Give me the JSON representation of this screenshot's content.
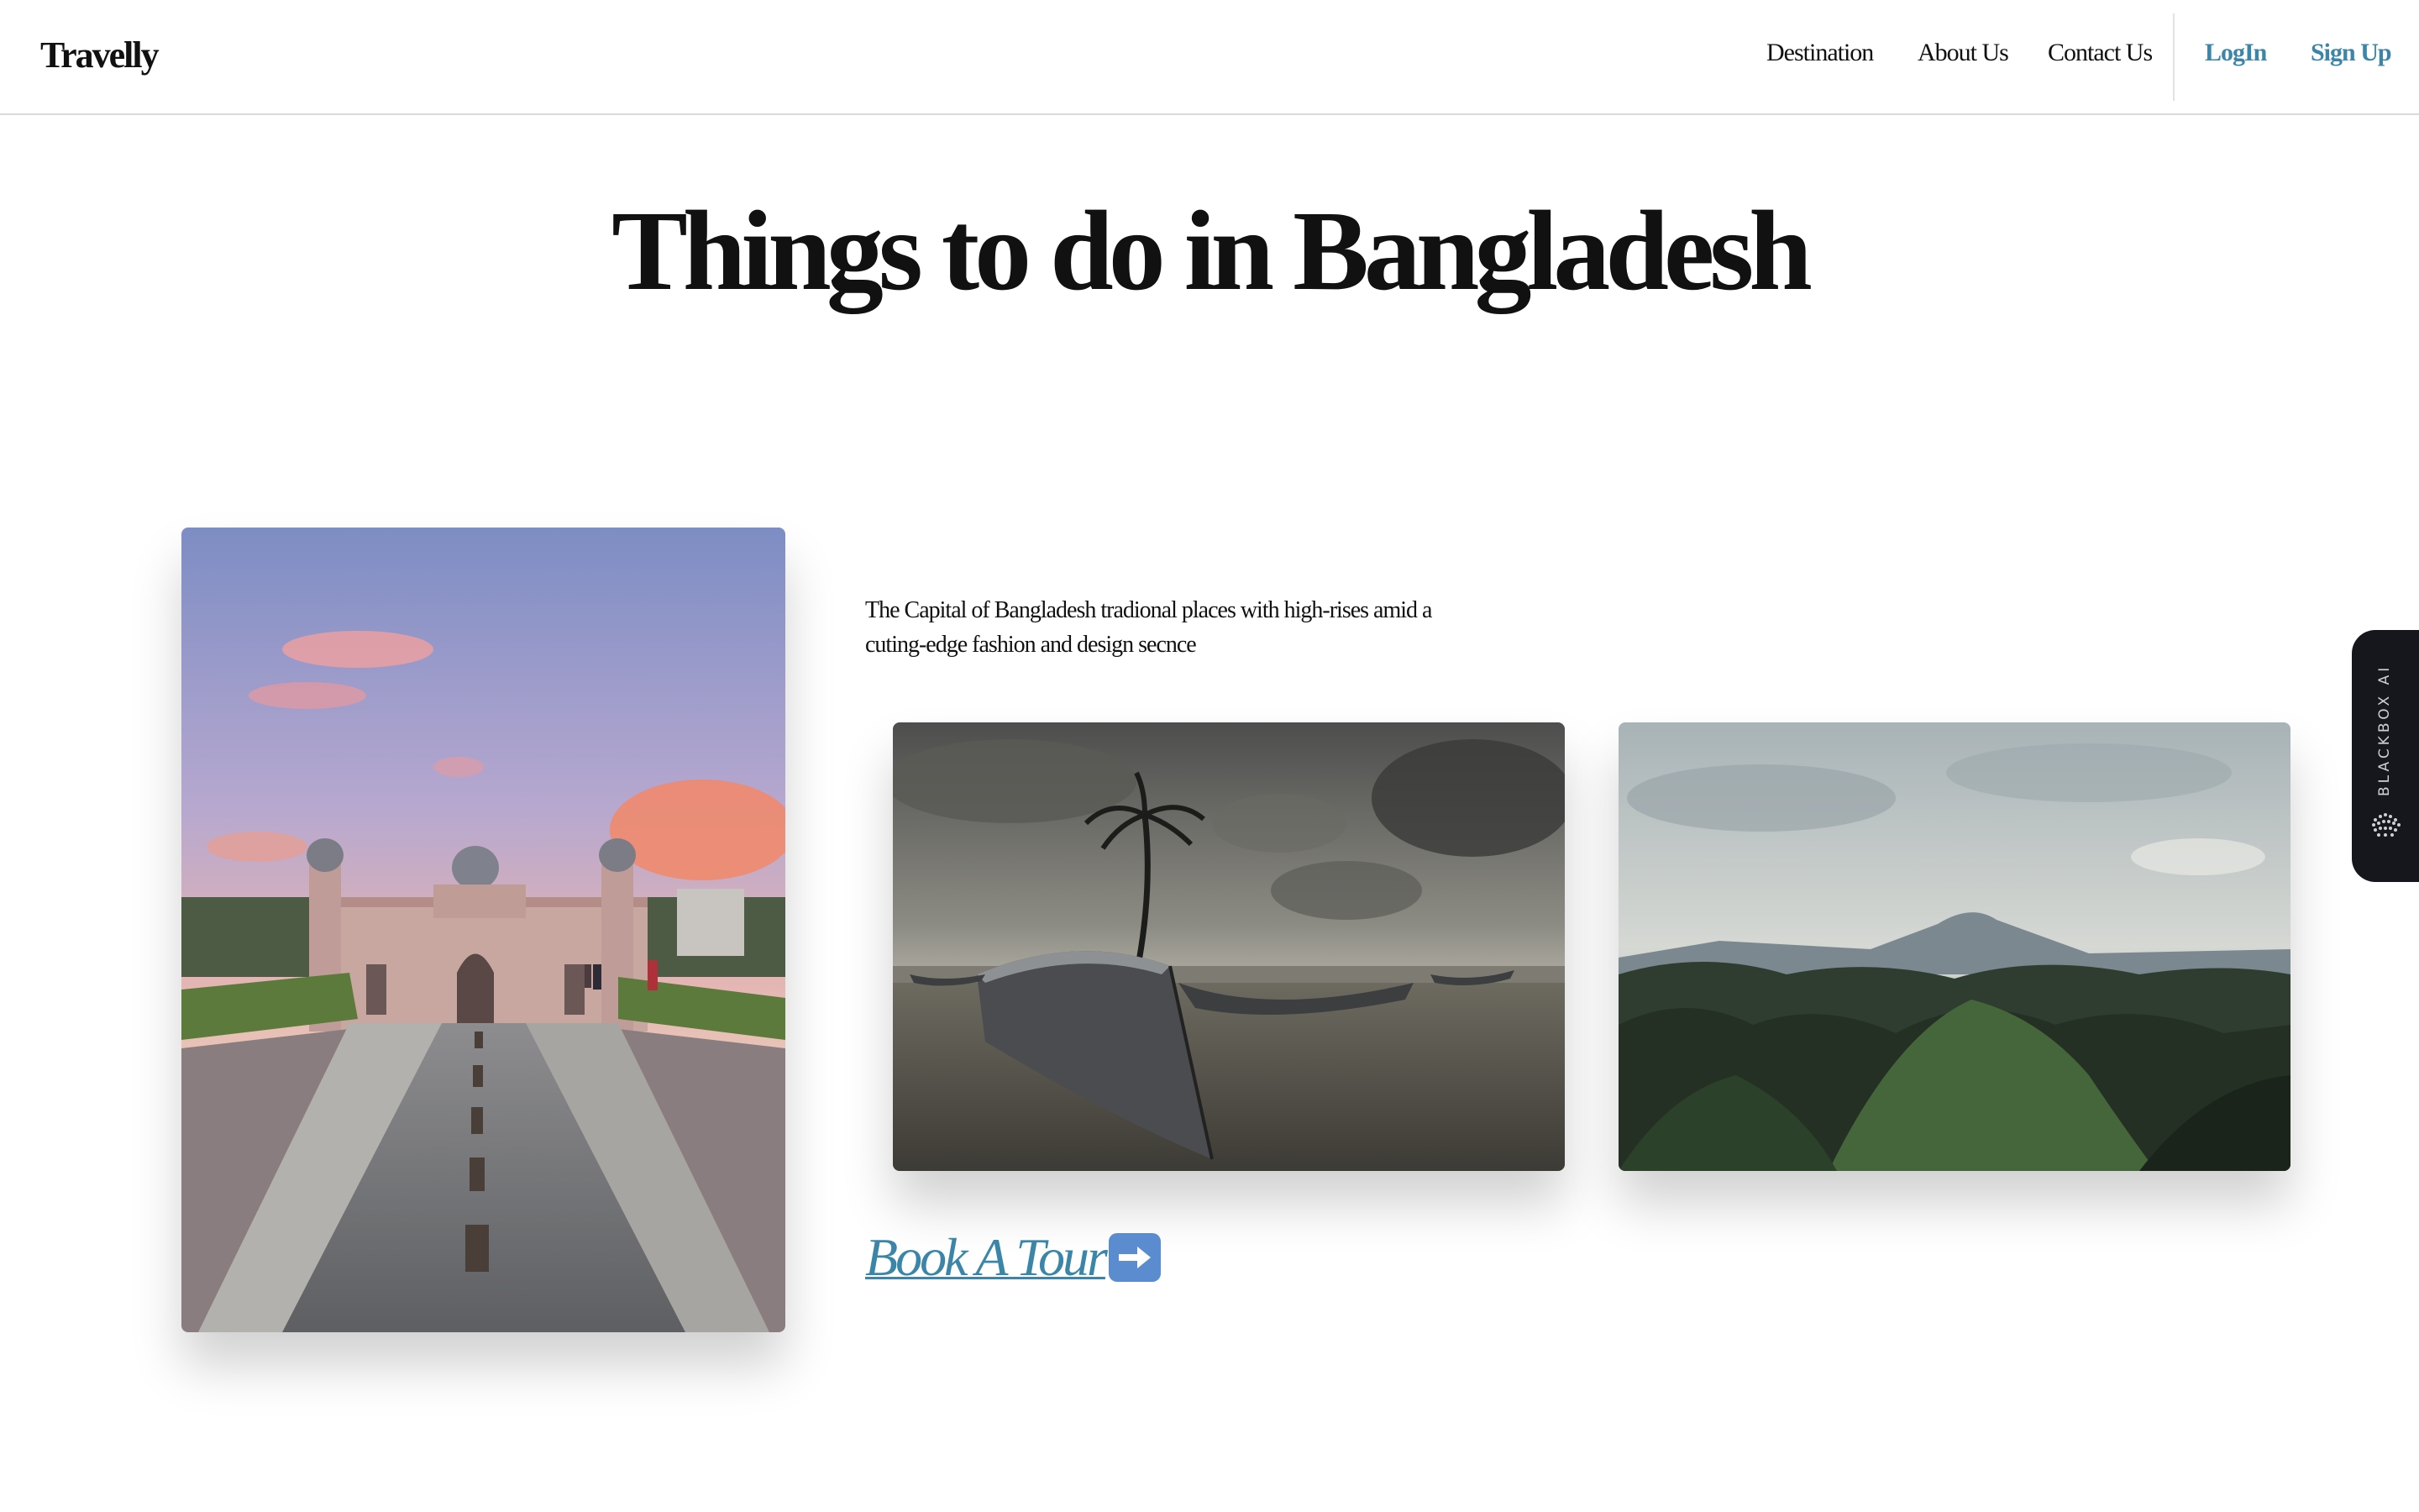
{
  "header": {
    "logo": "Travelly",
    "nav": {
      "destination": "Destination",
      "about": "About Us",
      "contact": "Contact Us",
      "login": "LogIn",
      "signup": "Sign Up"
    }
  },
  "main": {
    "title": "Things to do in Bangladesh",
    "description": "The Capital of Bangladesh tradional places with high-rises amid a cuting-edge fashion and design secnce",
    "cta_label": "Book A Tour",
    "cta_icon": "right-arrow-emoji-icon",
    "images": [
      "fort-photo",
      "beach-boat-photo",
      "green-hills-photo"
    ]
  },
  "side_widget": {
    "label": "BLACKBOX AI",
    "icon": "blackbox-dots-icon"
  },
  "colors": {
    "accent": "#3b86a8",
    "text": "#111111",
    "widget_bg": "#15171c"
  }
}
